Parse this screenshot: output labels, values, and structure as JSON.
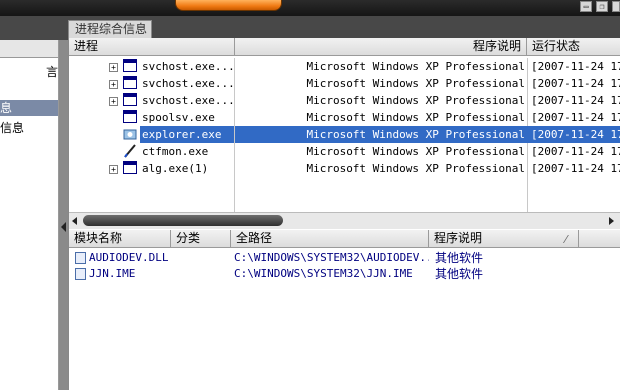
{
  "panel_tab": "进程综合信息",
  "left_items": [
    {
      "label": "言",
      "selected": false
    },
    {
      "label": "息",
      "selected": true
    },
    {
      "label": "信息",
      "selected": false
    }
  ],
  "process_columns": [
    "进程",
    "程序说明",
    "运行状态"
  ],
  "processes": [
    {
      "name": "svchost.exe...",
      "expandable": true,
      "icon": "window-icon",
      "desc": "Microsoft Windows XP Professional",
      "status": "[2007-11-24 17",
      "selected": false
    },
    {
      "name": "svchost.exe...",
      "expandable": true,
      "icon": "window-icon",
      "desc": "Microsoft Windows XP Professional",
      "status": "[2007-11-24 17",
      "selected": false
    },
    {
      "name": "svchost.exe...",
      "expandable": true,
      "icon": "window-icon",
      "desc": "Microsoft Windows XP Professional",
      "status": "[2007-11-24 17",
      "selected": false
    },
    {
      "name": "spoolsv.exe",
      "expandable": false,
      "icon": "window-icon",
      "desc": "Microsoft Windows XP Professional",
      "status": "[2007-11-24 17",
      "selected": false
    },
    {
      "name": "explorer.exe",
      "expandable": false,
      "icon": "explorer-icon",
      "desc": "Microsoft Windows XP Professional",
      "status": "[2007-11-24 17",
      "selected": true
    },
    {
      "name": "ctfmon.exe",
      "expandable": false,
      "icon": "pen-icon",
      "desc": "Microsoft Windows XP Professional",
      "status": "[2007-11-24 17",
      "selected": false
    },
    {
      "name": "alg.exe(1)",
      "expandable": true,
      "icon": "window-icon",
      "desc": "Microsoft Windows XP Professional",
      "status": "[2007-11-24 17",
      "selected": false
    }
  ],
  "module_columns": [
    "模块名称",
    "分类",
    "全路径",
    "程序说明"
  ],
  "modules": [
    {
      "name": "AUDIODEV.DLL",
      "path": "C:\\WINDOWS\\SYSTEM32\\AUDIODEV...",
      "desc": "其他软件"
    },
    {
      "name": "JJN.IME",
      "path": "C:\\WINDOWS\\SYSTEM32\\JJN.IME",
      "desc": "其他软件"
    }
  ],
  "colors": {
    "selection": "#316ac5",
    "module_text": "#000080",
    "accent_orange": "#f07a14"
  }
}
